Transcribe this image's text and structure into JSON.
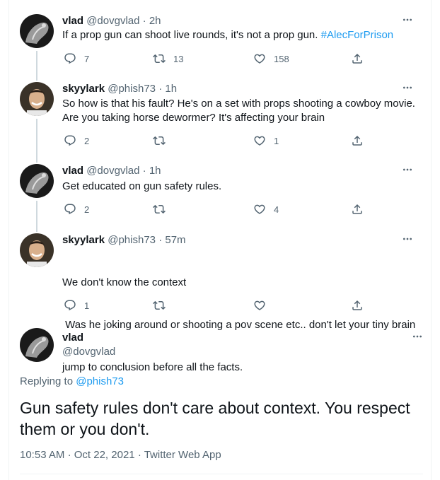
{
  "tweets": [
    {
      "name": "vlad",
      "handle": "@dovgvlad",
      "time": "2h",
      "text": "If a prop gun can shoot live rounds, it's not a prop gun. ",
      "hashtag": "#AlecForPrison",
      "reply_count": "7",
      "retweet_count": "13",
      "like_count": "158"
    },
    {
      "name": "skyylark",
      "handle": "@phish73",
      "time": "1h",
      "text_line1": "So how is that his fault? He's on a set with props shooting a cowboy movie.",
      "text_line2": "Are you taking horse dewormer? It's affecting your brain",
      "reply_count": "2",
      "retweet_count": "",
      "like_count": "1"
    },
    {
      "name": "vlad",
      "handle": "@dovgvlad",
      "time": "1h",
      "text": "Get educated on gun safety rules.",
      "reply_count": "2",
      "retweet_count": "",
      "like_count": "4"
    },
    {
      "name": "skyylark",
      "handle": "@phish73",
      "time": "57m",
      "text_line1": "We don't know the context",
      "text_line2": " Was he joking around or shooting a pov scene etc.. don't let your tiny brain",
      "text_line3": "jump to conclusion before all the facts.",
      "reply_count": "1",
      "retweet_count": "",
      "like_count": ""
    }
  ],
  "main_tweet": {
    "name": "vlad",
    "handle": "@dovgvlad",
    "replying_prefix": "Replying to ",
    "replying_to": "@phish73",
    "text_line1": "Gun safety rules don't care about context. You respect",
    "text_line2": "them or you don't.",
    "time": "10:53 AM",
    "date": "Oct 22, 2021",
    "source": "Twitter Web App"
  },
  "icons": {
    "reply": "reply-icon",
    "retweet": "retweet-icon",
    "like": "heart-icon",
    "share": "share-icon",
    "more": "more-icon"
  },
  "colors": {
    "text": "#0f1419",
    "secondary": "#536471",
    "link": "#1d9bf0",
    "thread_line": "#cfd9de"
  }
}
